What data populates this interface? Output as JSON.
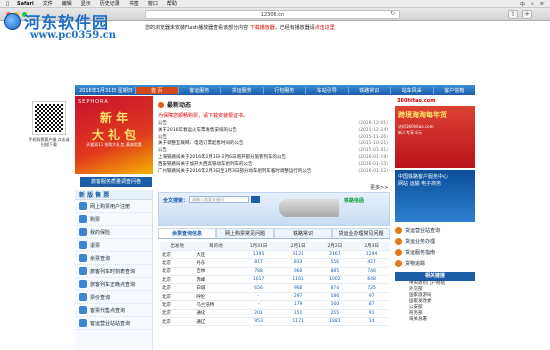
{
  "menubar": {
    "items": [
      "Safari",
      "文件",
      "编辑",
      "显示",
      "历史记录",
      "书签",
      "窗口",
      "帮助"
    ],
    "right": [
      "中",
      "⌕",
      "≡"
    ]
  },
  "browser": {
    "url": "12306.cn"
  },
  "watermark": {
    "title": "河东软件园",
    "url": "www.pc0359.cn"
  },
  "banner": {
    "text": "您的浏览器未安装Flash播放器查看该部分内容",
    "link1": "下载播放器",
    "text2": "，已经有播放器请",
    "link2": "点击这里"
  },
  "nav": {
    "date": "2016年1月31日 星期日",
    "items": [
      "首 页",
      "客运服务",
      "货运服务",
      "行包服务",
      "车站引导",
      "铁路常识",
      "站车风采",
      "客户信箱"
    ]
  },
  "left_ad": {
    "brand": "SEPHORA",
    "big1": "新 年",
    "big2": "大 礼 包",
    "small": "天猫双11 抢购大礼包 满减优惠",
    "button": "旅客服务质量调查问卷"
  },
  "qr": {
    "text": "手机购票客户端 点击或扫描下载"
  },
  "sidebar": {
    "header": "新 版 售 票",
    "items": [
      "网上购票用户注册",
      "购票",
      "我的保险",
      "退票",
      "余票查询",
      "旅客列车时刻表查询",
      "旅客列车正晚点查询",
      "票价查询",
      "客票代售点查询",
      "客运营业站站查询"
    ]
  },
  "news": {
    "title": "最新动态",
    "lead": "为保障您顺畅购票，请下载安装根证书。",
    "items": [
      {
        "t": "公告",
        "d": "(2016-12-01)"
      },
      {
        "t": "关于2016年春运火车票发售安排的公告",
        "d": "(2015-12-14)"
      },
      {
        "t": "公告",
        "d": "(2015-11-26)"
      },
      {
        "t": "关于调整互联网、电话订票起售时间的公告",
        "d": "(2015-10-21)"
      },
      {
        "t": "公告",
        "d": "(2015-01-01)"
      },
      {
        "t": "上海铁路局关于2016年2月1日-2月6日增开部分旅客列车的公告",
        "d": "(2016-01-19)"
      },
      {
        "t": "西安铁路局关于加开大西高铁动车组列车的公告",
        "d": "(2016-01-15)"
      },
      {
        "t": "广州铁路局关于2016年2月3日至3月3日部分动车组列车临时调整运行的公告",
        "d": "(2016-01-12)"
      }
    ],
    "more": "更多>>"
  },
  "right_ad": {
    "brand": "360hitao.com",
    "big": "跨境海淘每年货",
    "sub": "访问360hitao.com",
    "tag": "新人专享 8元",
    "ad2_title": "中国铁路客户服务中心",
    "ad2_sub": "网站 运输 电子商务"
  },
  "right_links": {
    "items": [
      "货运营业站查询",
      "货运业务办理",
      "货运服务指南",
      "货物追踪"
    ],
    "header": "相关链接",
    "links": [
      "中央政府门户网站",
      "外交部",
      "国家旅游局",
      "国家发改委",
      "公安部",
      "商务部",
      "海关总署"
    ]
  },
  "search": {
    "label": "全文搜索：",
    "placeholder": "请输入搜索关键词",
    "tag": "铁路信函"
  },
  "tabs": [
    "余票查询信息",
    "网上购票常见问题",
    "铁路常识",
    "货运业办理常见问题"
  ],
  "table": {
    "headers": [
      "出发地",
      "目的地",
      "1月31日",
      "2月1日",
      "2月2日",
      "2月3日"
    ],
    "rows": [
      [
        "北京",
        "大连",
        "1195",
        "3121",
        "2167",
        "1294"
      ],
      [
        "北京",
        "丹东",
        "817",
        "833",
        "556",
        "427"
      ],
      [
        "北京",
        "吉林",
        "788",
        "960",
        "885",
        "748"
      ],
      [
        "北京",
        "赤峰",
        "1017",
        "1161",
        "1002",
        "648"
      ],
      [
        "北京",
        "白城",
        "656",
        "966",
        "874",
        "725"
      ],
      [
        "北京",
        "呼伦",
        "-",
        "297",
        "186",
        "97"
      ],
      [
        "北京",
        "乌兰浩特",
        "-",
        "179",
        "160",
        "87"
      ],
      [
        "北京",
        "通化",
        "201",
        "151",
        "255",
        "91"
      ],
      [
        "北京",
        "通辽",
        "953",
        "1171",
        "1881",
        "14"
      ]
    ]
  }
}
